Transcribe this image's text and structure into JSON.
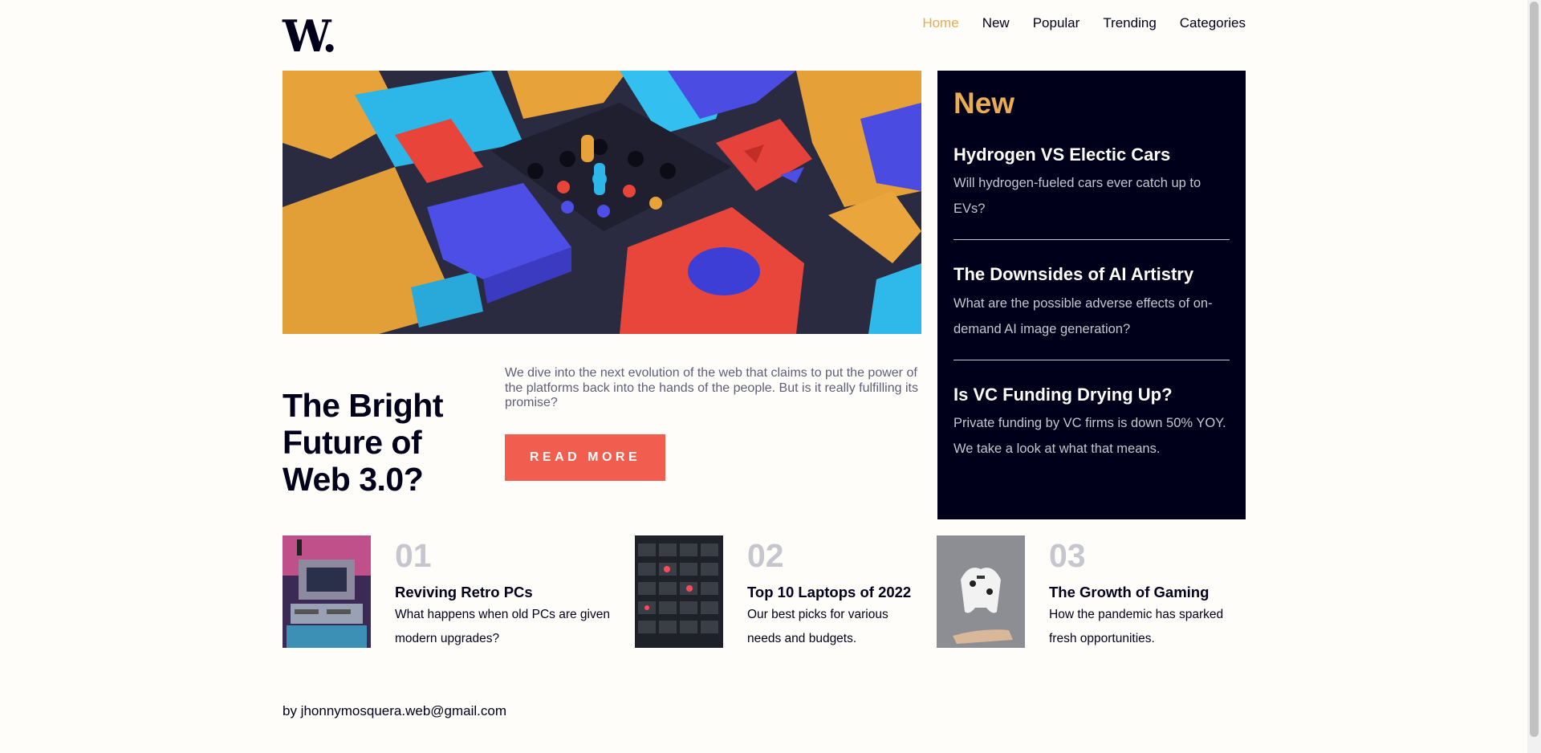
{
  "header": {
    "logo": "W.",
    "nav": [
      "Home",
      "New",
      "Popular",
      "Trending",
      "Categories"
    ],
    "active_nav": "Home"
  },
  "hero": {
    "title": "The Bright Future of Web 3.0?",
    "description": "We dive into the next evolution of the web that claims to put the power of the platforms back into the hands of the people. But is it really fulfilling its promise?",
    "button": "READ MORE"
  },
  "sidebar": {
    "title": "New",
    "items": [
      {
        "title": "Hydrogen VS Electic Cars",
        "desc": "Will hydrogen-fueled cars ever catch up to EVs?"
      },
      {
        "title": "The Downsides of AI Artistry",
        "desc": "What are the possible adverse effects of on-demand AI image generation?"
      },
      {
        "title": "Is VC Funding Drying Up?",
        "desc": "Private funding by VC firms is down 50% YOY. We take a look at what that means."
      }
    ]
  },
  "cards": [
    {
      "num": "01",
      "title": "Reviving Retro PCs",
      "desc": "What happens when old PCs are given modern upgrades?"
    },
    {
      "num": "02",
      "title": "Top 10 Laptops of 2022",
      "desc": "Our best picks for various needs and budgets."
    },
    {
      "num": "03",
      "title": "The Growth of Gaming",
      "desc": "How the pandemic has sparked fresh opportunities."
    }
  ],
  "footer": {
    "text": "by jhonnymosquera.web@gmail.com"
  },
  "colors": {
    "background": "#fffdfa",
    "dark": "#00001a",
    "accent_orange": "#e9ab53",
    "accent_red": "#f15e50",
    "muted": "#c5c6ce"
  }
}
